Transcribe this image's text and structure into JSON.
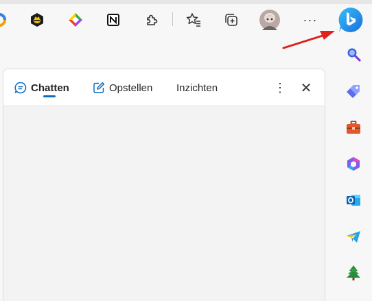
{
  "toolbar": {
    "extensions": [
      {
        "icon": "partial-extension-icon"
      },
      {
        "icon": "bee-extension-icon"
      },
      {
        "icon": "colorful-diamond-extension-icon"
      },
      {
        "icon": "notion-extension-icon"
      },
      {
        "icon": "puzzle-extensions-icon"
      },
      {
        "icon": "favorites-icon"
      },
      {
        "icon": "collections-icon"
      },
      {
        "icon": "profile-avatar"
      },
      {
        "icon": "more-options-icon"
      },
      {
        "icon": "bing-chat-icon"
      }
    ],
    "more_label": "···"
  },
  "panel": {
    "tabs": [
      {
        "label": "Chatten",
        "icon": "chat-icon",
        "selected": true
      },
      {
        "label": "Opstellen",
        "icon": "compose-icon",
        "selected": false
      },
      {
        "label": "Inzichten",
        "selected": false
      }
    ],
    "more_label": "⋮",
    "close_label": "✕",
    "accent_color": "#0f6cbd"
  },
  "sidebar": {
    "items": [
      {
        "icon": "search-icon"
      },
      {
        "icon": "shopping-tag-icon"
      },
      {
        "icon": "tools-briefcase-icon"
      },
      {
        "icon": "microsoft365-icon"
      },
      {
        "icon": "outlook-icon"
      },
      {
        "icon": "telegram-icon"
      },
      {
        "icon": "tree-icon"
      }
    ]
  },
  "annotation": {
    "color": "#e0211c"
  }
}
